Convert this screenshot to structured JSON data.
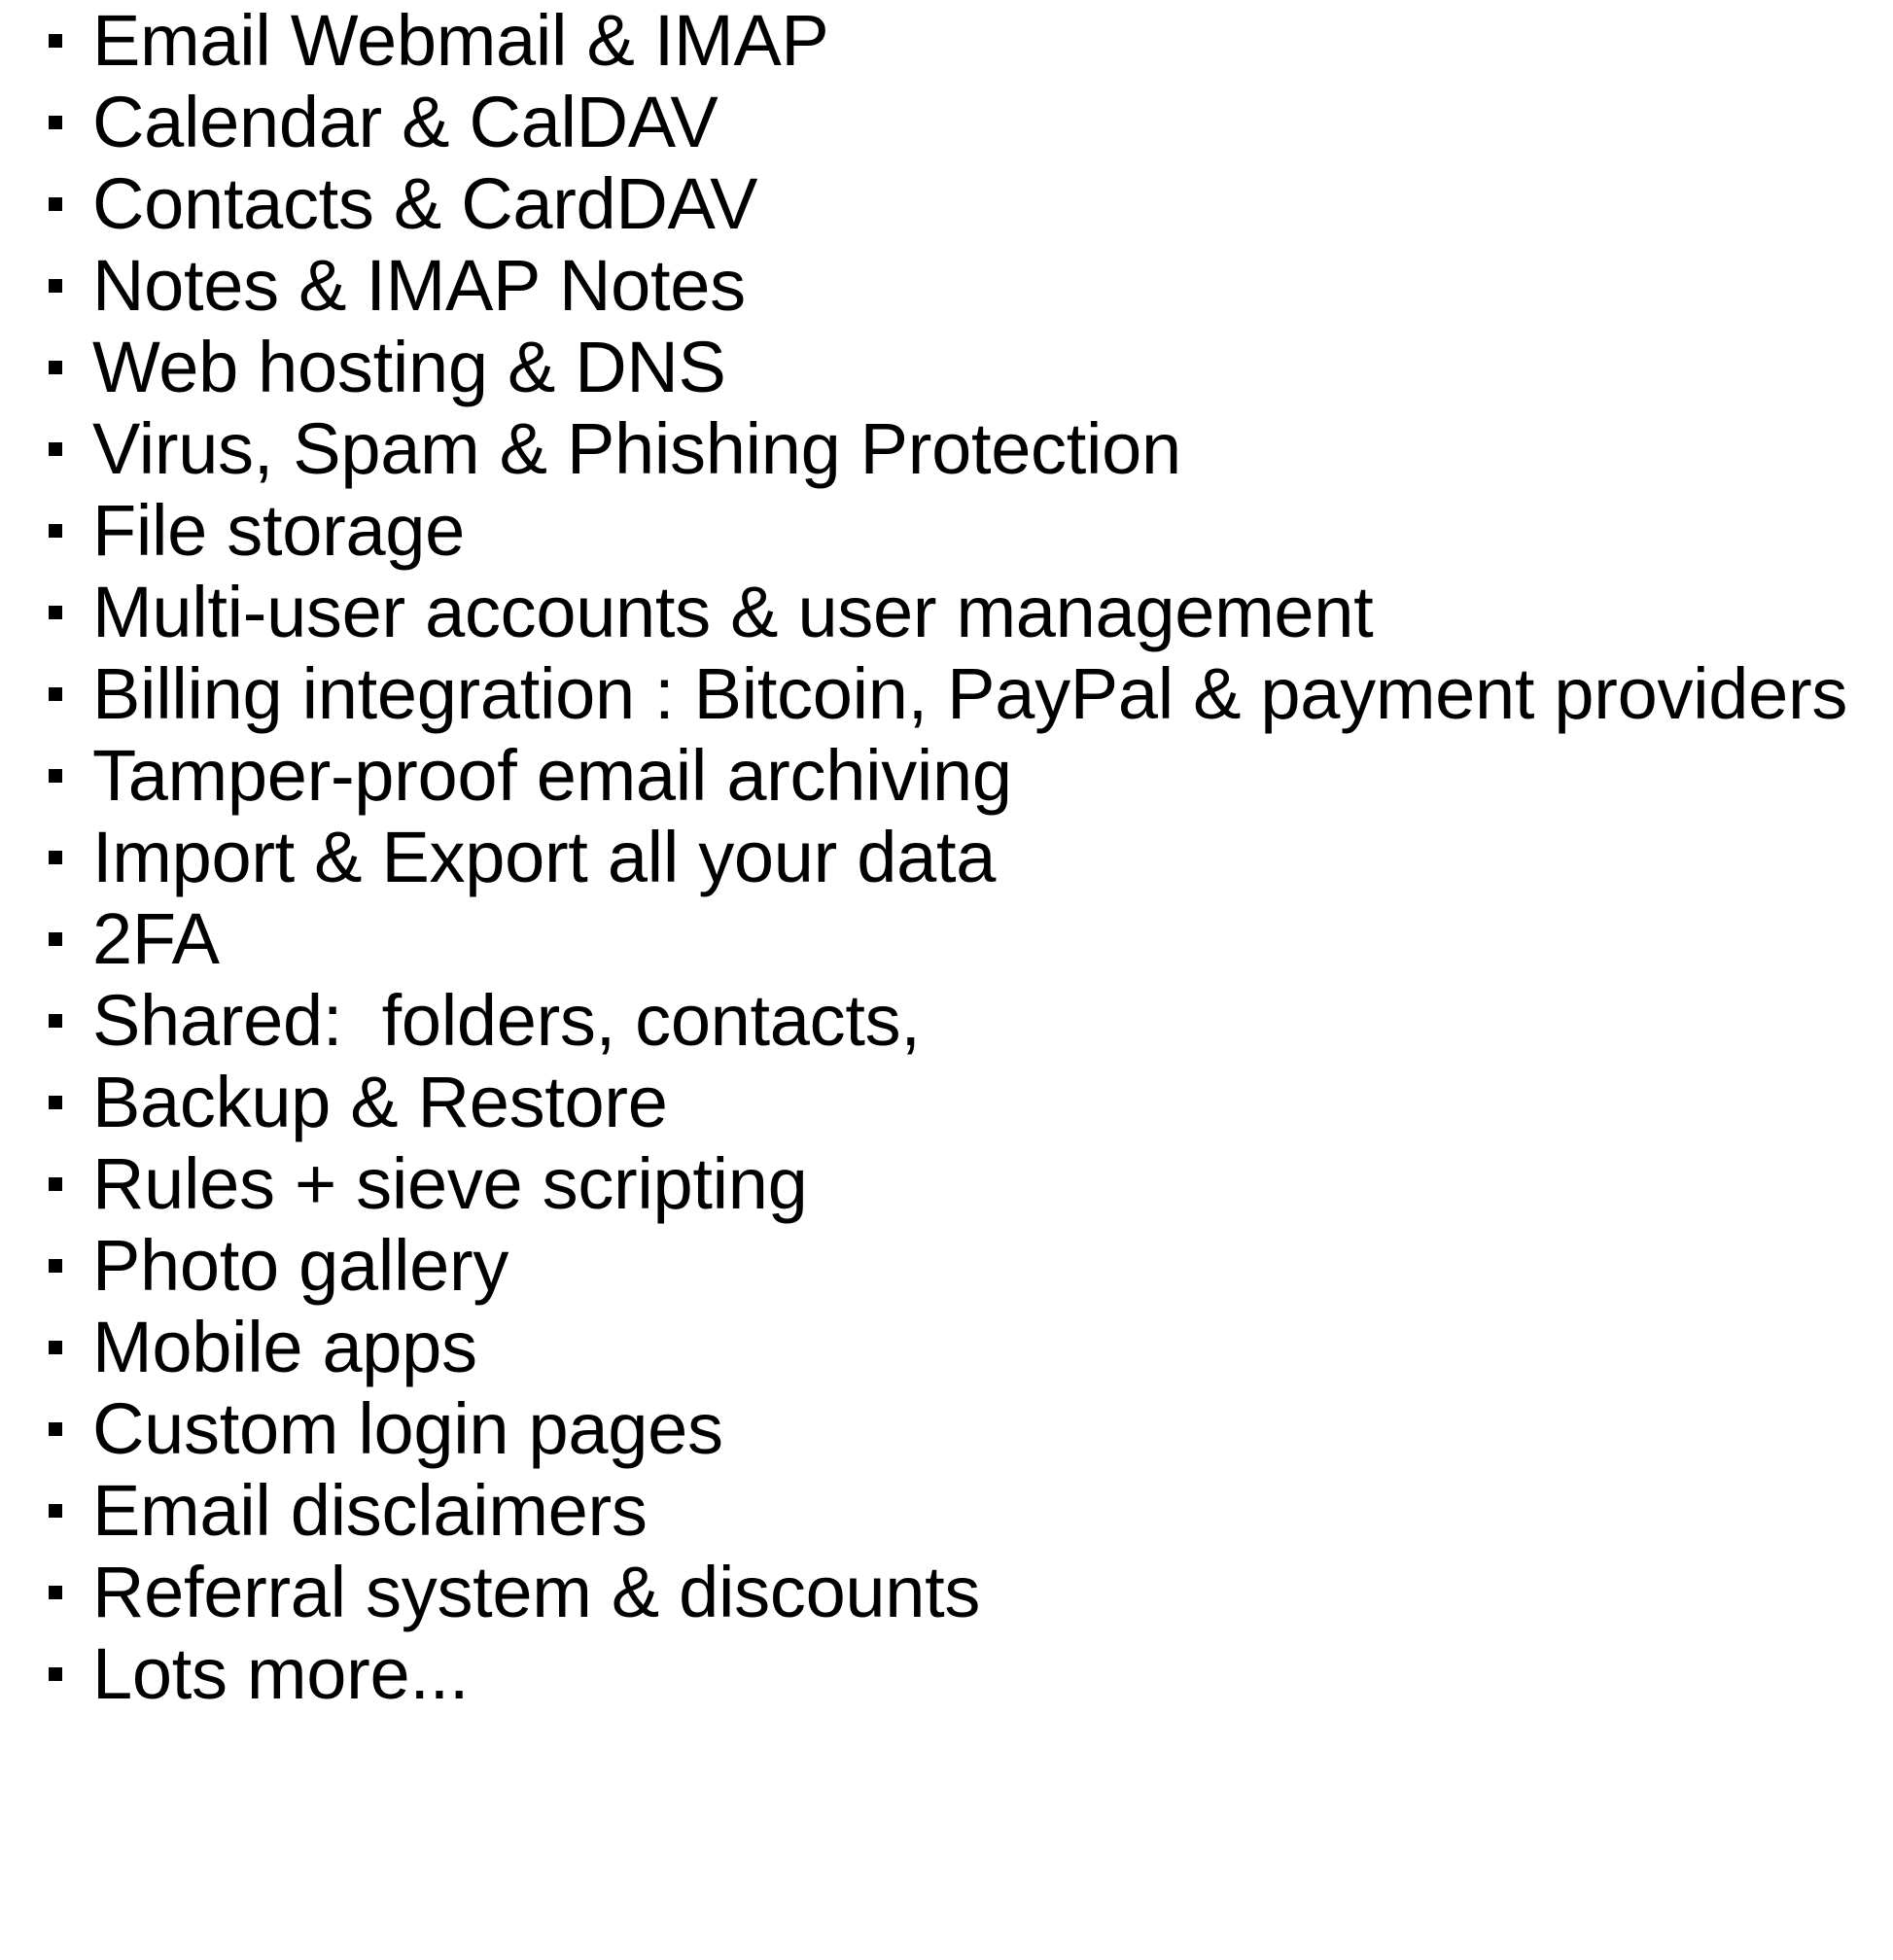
{
  "features": [
    "Email Webmail & IMAP",
    "Calendar & CalDAV",
    "Contacts & CardDAV",
    "Notes & IMAP Notes",
    "Web hosting & DNS",
    "Virus, Spam & Phishing Protection",
    "File storage",
    "Multi-user accounts & user management",
    "Billing integration : Bitcoin, PayPal & payment providers",
    "Tamper-proof email archiving",
    "Import & Export all your data",
    "2FA",
    "Shared:  folders, contacts,",
    "Backup & Restore",
    "Rules + sieve scripting",
    "Photo gallery",
    "Mobile apps",
    "Custom login pages",
    "Email disclaimers",
    "Referral system & discounts",
    "Lots more..."
  ]
}
